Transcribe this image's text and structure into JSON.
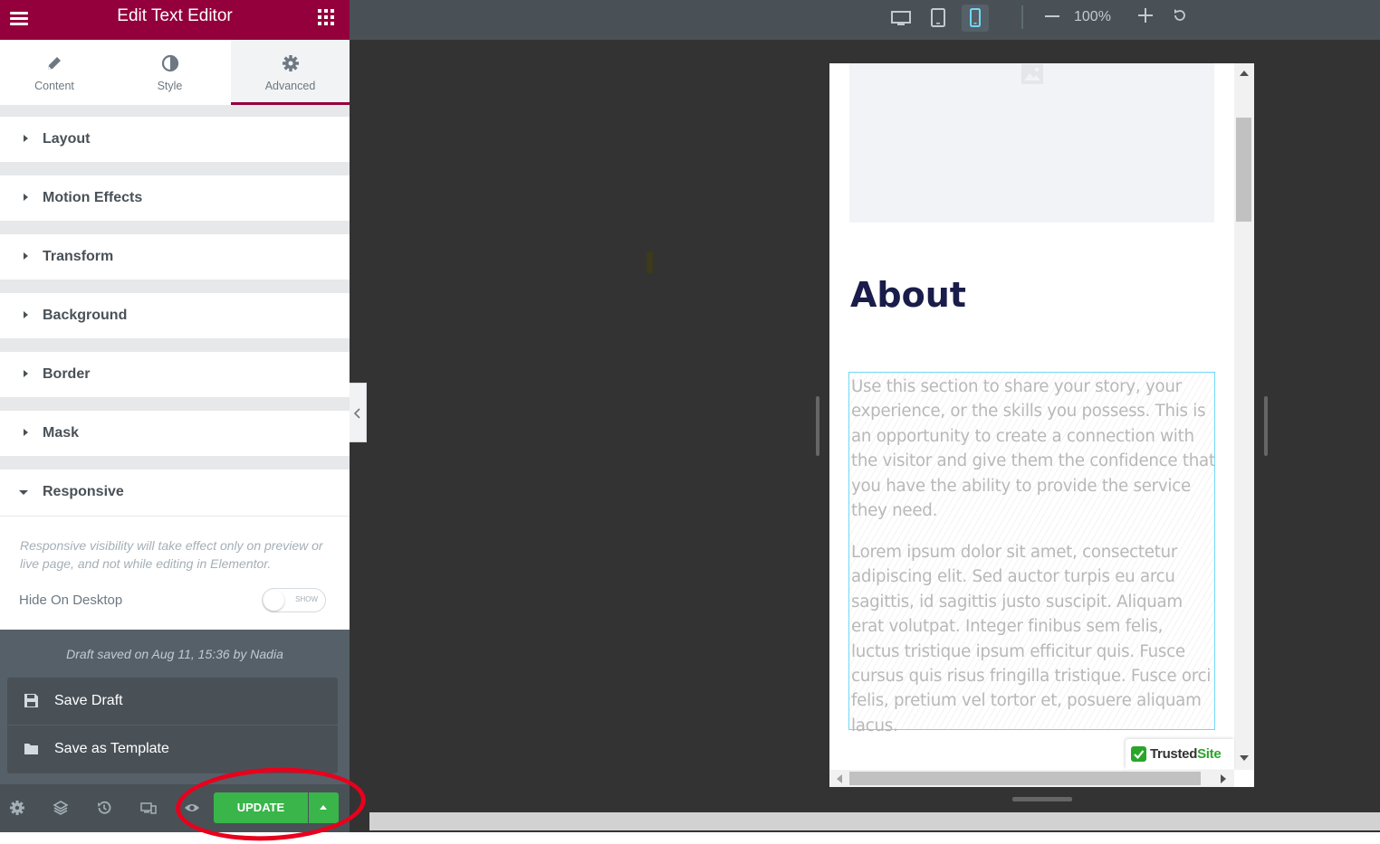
{
  "panel": {
    "title": "Edit Text Editor",
    "menu_icon": "hamburger-icon",
    "apps_icon": "apps-grid-icon"
  },
  "tabs": [
    {
      "label": "Content",
      "icon": "pencil-icon"
    },
    {
      "label": "Style",
      "icon": "contrast-icon"
    },
    {
      "label": "Advanced",
      "icon": "gear-icon",
      "active": true
    }
  ],
  "sections": [
    {
      "label": "Layout",
      "open": false
    },
    {
      "label": "Motion Effects",
      "open": false
    },
    {
      "label": "Transform",
      "open": false
    },
    {
      "label": "Background",
      "open": false
    },
    {
      "label": "Border",
      "open": false
    },
    {
      "label": "Mask",
      "open": false
    },
    {
      "label": "Responsive",
      "open": true
    }
  ],
  "responsive": {
    "note": "Responsive visibility will take effect only on preview or live page, and not while editing in Elementor.",
    "hide_desktop_label": "Hide On Desktop",
    "toggle_state": "SHOW"
  },
  "save": {
    "draft_note": "Draft saved on Aug 11, 15:36 by Nadia",
    "items": [
      {
        "label": "Save Draft",
        "icon": "save-icon"
      },
      {
        "label": "Save as Template",
        "icon": "folder-icon"
      }
    ],
    "update_label": "UPDATE"
  },
  "footer_icons": [
    "settings-icon",
    "layers-icon",
    "history-icon",
    "responsive-mode-icon",
    "preview-eye-icon"
  ],
  "topbar": {
    "devices": [
      "desktop-icon",
      "tablet-icon",
      "mobile-icon"
    ],
    "active_device": "mobile",
    "zoom": "100%"
  },
  "preview": {
    "heading": "About",
    "paragraph_1": "Use this section to share your story, your experience, or the skills you possess. This is an opportunity to create a connection with the visitor and give them the confidence that you have the ability to provide the service they need.",
    "paragraph_2": "Lorem ipsum dolor sit amet, consectetur adipiscing elit. Sed auctor turpis eu arcu sagittis, id sagittis justo suscipit. Aliquam erat volutpat. Integer finibus sem felis, luctus tristique ipsum efficitur quis. Fusce cursus quis risus fringilla tristique. Fusce orci felis, pretium vel tortor et, posuere aliquam lacus.",
    "badge_text_1": "Trusted",
    "badge_text_2": "Site"
  },
  "colors": {
    "brand": "#93003c",
    "update": "#39b54a",
    "annotation": "#e8001c",
    "selection_border": "#71d7f7"
  }
}
